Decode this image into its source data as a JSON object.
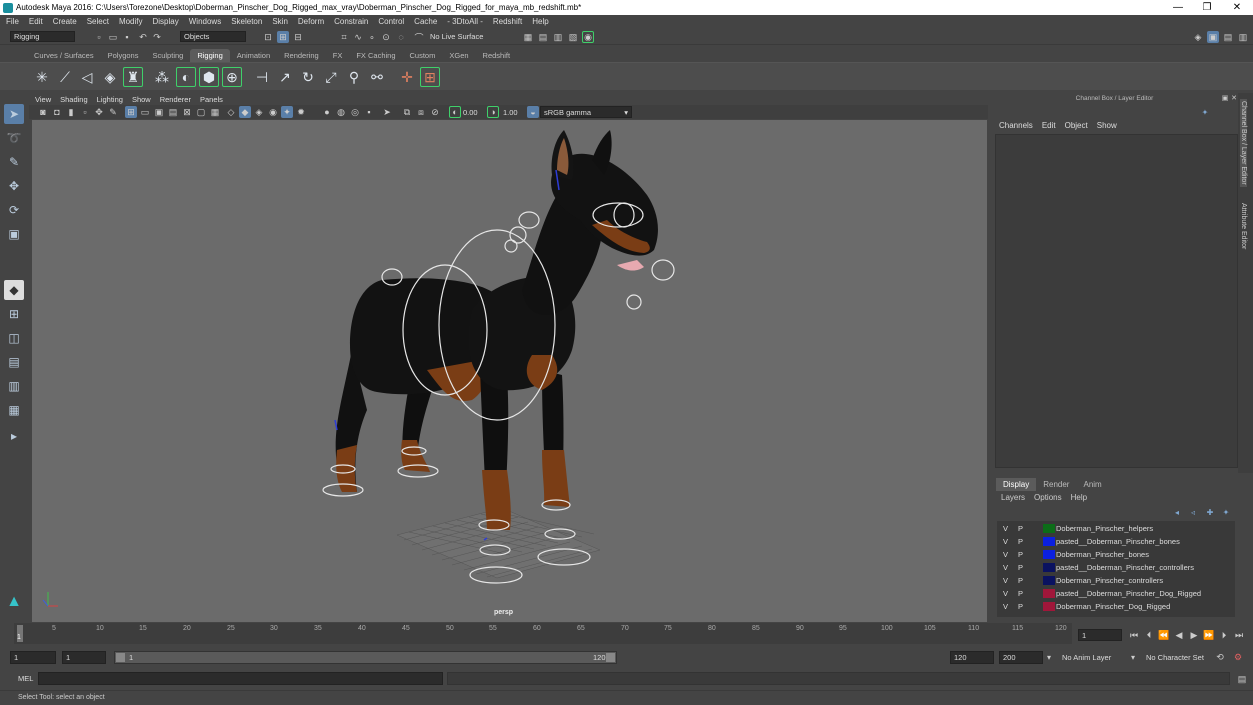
{
  "window": {
    "title": "Autodesk Maya 2016: C:\\Users\\Torezone\\Desktop\\Doberman_Pinscher_Dog_Rigged_max_vray\\Doberman_Pinscher_Dog_Rigged_for_maya_mb_redshift.mb*",
    "minimize": "—",
    "maximize": "❐",
    "close": "✕"
  },
  "menu": [
    "File",
    "Edit",
    "Create",
    "Select",
    "Modify",
    "Display",
    "Windows",
    "Skeleton",
    "Skin",
    "Deform",
    "Constrain",
    "Control",
    "Cache",
    "- 3DtoAll -",
    "Redshift",
    "Help"
  ],
  "status": {
    "mode": "Rigging",
    "selection_field": "Objects",
    "live_surface": "No Live Surface"
  },
  "shelf_tabs": [
    "Curves / Surfaces",
    "Polygons",
    "Sculpting",
    "Rigging",
    "Animation",
    "Rendering",
    "FX",
    "FX Caching",
    "Custom",
    "XGen",
    "Redshift"
  ],
  "active_shelf_tab": "Rigging",
  "viewport": {
    "menu": [
      "View",
      "Shading",
      "Lighting",
      "Show",
      "Renderer",
      "Panels"
    ],
    "exposure": "0.00",
    "gamma": "1.00",
    "color_space": "sRGB gamma",
    "camera": "persp",
    "background_color": "#6b6b6b"
  },
  "channel_box": {
    "title": "Channel Box / Layer Editor",
    "menu": [
      "Channels",
      "Edit",
      "Object",
      "Show"
    ],
    "side_tabs": [
      "Channel Box / Layer Editor",
      "Attribute Editor"
    ]
  },
  "layer_editor": {
    "tabs": [
      "Display",
      "Render",
      "Anim"
    ],
    "active_tab": "Display",
    "menu": [
      "Layers",
      "Options",
      "Help"
    ],
    "layers": [
      {
        "v": "V",
        "p": "P",
        "color": "#0c6d18",
        "name": "Doberman_Pinscher_helpers"
      },
      {
        "v": "V",
        "p": "P",
        "color": "#0b20e0",
        "name": "pasted__Doberman_Pinscher_bones"
      },
      {
        "v": "V",
        "p": "P",
        "color": "#0b20e0",
        "name": "Doberman_Pinscher_bones"
      },
      {
        "v": "V",
        "p": "P",
        "color": "#0a1260",
        "name": "pasted__Doberman_Pinscher_controllers"
      },
      {
        "v": "V",
        "p": "P",
        "color": "#0a1260",
        "name": "Doberman_Pinscher_controllers"
      },
      {
        "v": "V",
        "p": "P",
        "color": "#a0173a",
        "name": "pasted__Doberman_Pinscher_Dog_Rigged"
      },
      {
        "v": "V",
        "p": "P",
        "color": "#a0173a",
        "name": "Doberman_Pinscher_Dog_Rigged"
      }
    ]
  },
  "timeline": {
    "ticks": [
      "5",
      "10",
      "15",
      "20",
      "25",
      "30",
      "35",
      "40",
      "45",
      "50",
      "55",
      "60",
      "65",
      "70",
      "75",
      "80",
      "85",
      "90",
      "95",
      "100",
      "105",
      "110",
      "115",
      "120"
    ],
    "start_marker": "1",
    "current_frame": "1"
  },
  "range": {
    "start": "1",
    "playback_start": "1",
    "slider_start": "1",
    "slider_end": "120",
    "end": "120",
    "anim_end": "200",
    "anim_layer": "No Anim Layer",
    "character_set": "No Character Set"
  },
  "command": {
    "label": "MEL"
  },
  "help_line": "Select Tool: select an object"
}
